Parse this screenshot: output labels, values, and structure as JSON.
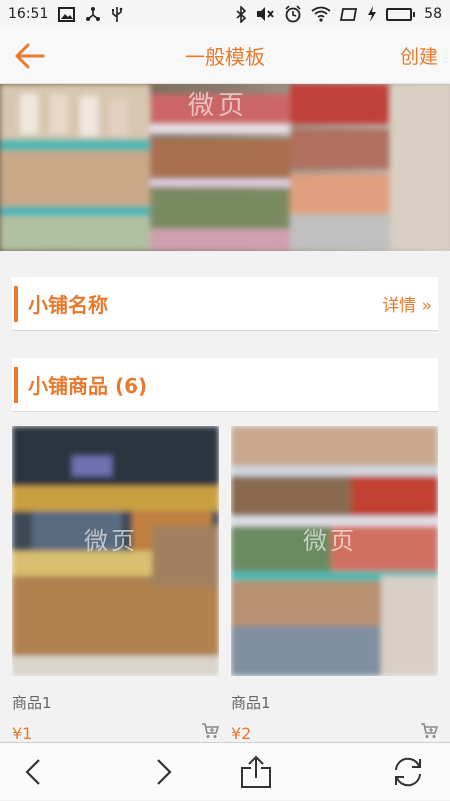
{
  "status_bar": {
    "time": "16:51",
    "battery_level": 58,
    "battery_text": "58",
    "icons": [
      "image-icon",
      "usb-share-icon",
      "usb-icon",
      "bluetooth-icon",
      "mute-icon",
      "alarm-icon",
      "wifi-icon",
      "rotate-icon",
      "charging-icon",
      "battery-icon"
    ]
  },
  "nav": {
    "back_icon": "back-arrow-icon",
    "title": "一般模板",
    "create_label": "创建"
  },
  "banner": {
    "watermark": "微页"
  },
  "shop_section": {
    "title": "小铺名称",
    "details_link": "详情 »"
  },
  "products_section": {
    "title": "小铺商品 (6)"
  },
  "products": [
    {
      "name": "商品1",
      "price": "¥1",
      "watermark": "微页"
    },
    {
      "name": "商品1",
      "price": "¥2",
      "watermark": "微页"
    }
  ],
  "bottom_bar": {
    "icons": [
      "back-chevron-icon",
      "forward-chevron-icon",
      "share-icon",
      "refresh-icon"
    ]
  },
  "colors": {
    "accent": "#e87a2e",
    "background": "#f2f2f2",
    "battery_green": "#3dbb3d"
  }
}
